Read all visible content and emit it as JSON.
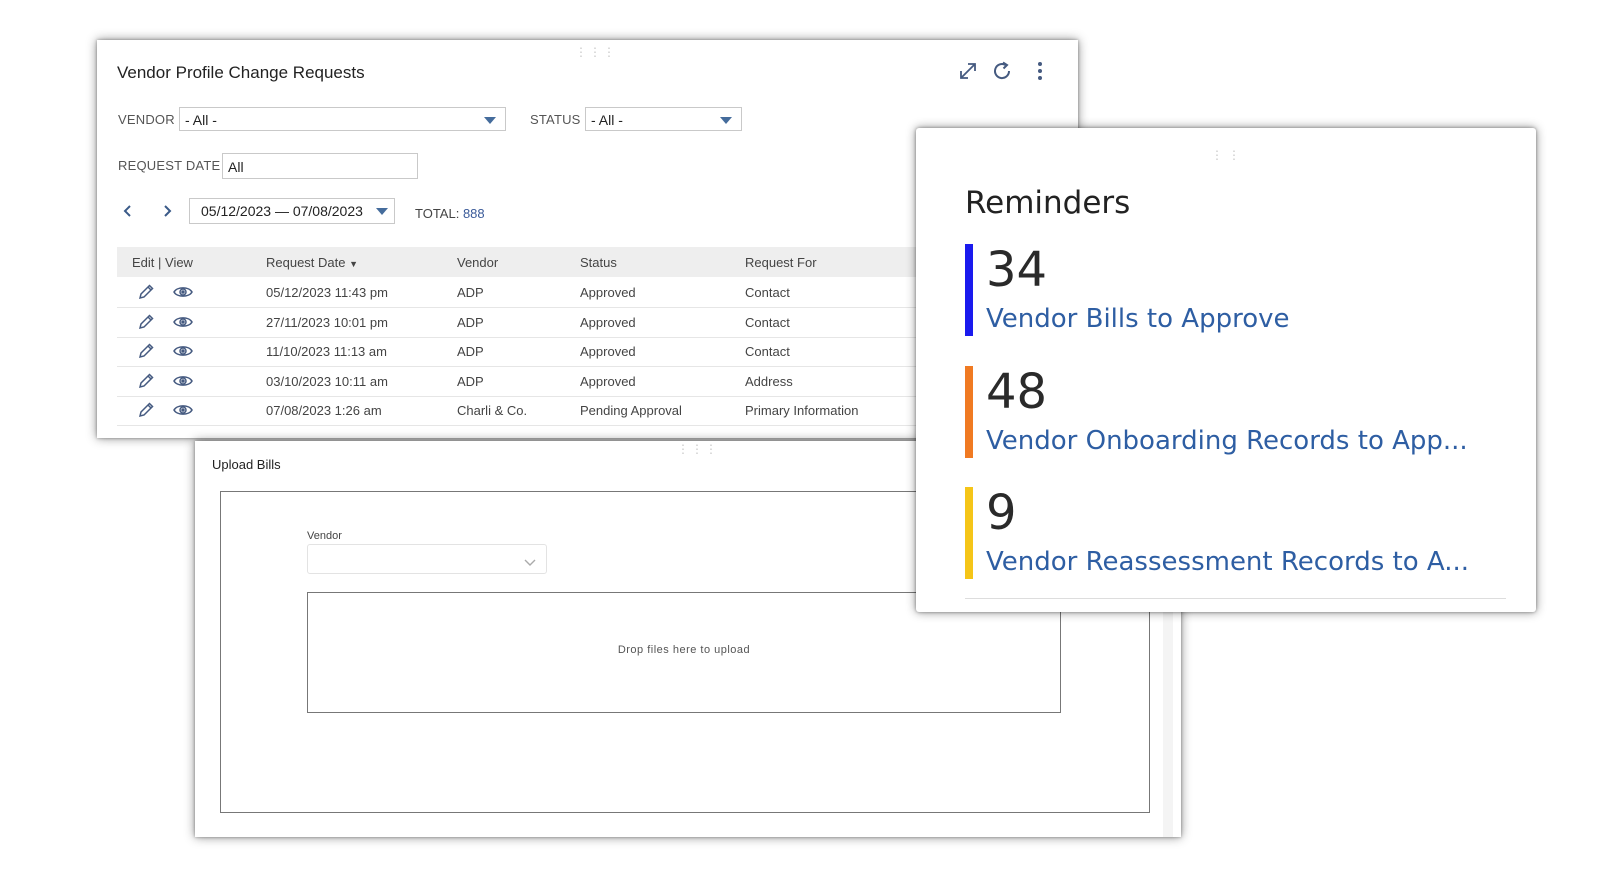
{
  "vendor_profile": {
    "title": "Vendor Profile Change Requests",
    "filters": {
      "vendor_label": "VENDOR",
      "vendor_value": "- All -",
      "status_label": "STATUS",
      "status_value": "- All -",
      "request_date_label": "REQUEST DATE",
      "request_date_value": "All"
    },
    "date_range": "05/12/2023 — 07/08/2023",
    "total_label": "TOTAL:",
    "total_value": "888",
    "columns": {
      "edit_view": "Edit | View",
      "request_date": "Request Date",
      "vendor": "Vendor",
      "status": "Status",
      "request_for": "Request For"
    },
    "rows": [
      {
        "date": "05/12/2023 11:43 pm",
        "vendor": "ADP",
        "status": "Approved",
        "request_for": "Contact"
      },
      {
        "date": "27/11/2023 10:01 pm",
        "vendor": "ADP",
        "status": "Approved",
        "request_for": "Contact"
      },
      {
        "date": "11/10/2023 11:13 am",
        "vendor": "ADP",
        "status": "Approved",
        "request_for": "Contact"
      },
      {
        "date": "03/10/2023 10:11 am",
        "vendor": "ADP",
        "status": "Approved",
        "request_for": "Address"
      },
      {
        "date": "07/08/2023 1:26 am",
        "vendor": "Charli & Co.",
        "status": "Pending Approval",
        "request_for": "Primary Information"
      }
    ],
    "icons": [
      "expand-icon",
      "refresh-icon",
      "more-vertical-icon",
      "chevron-left-icon",
      "chevron-right-icon",
      "pencil-icon",
      "eye-icon",
      "sort-desc-icon"
    ]
  },
  "upload_bills": {
    "title": "Upload Bills",
    "vendor_label": "Vendor",
    "vendor_value": "",
    "dropzone_text": "Drop files here to upload"
  },
  "reminders": {
    "title": "Reminders",
    "items": [
      {
        "count": "34",
        "label": "Vendor Bills to Approve",
        "color": "#1a1aee"
      },
      {
        "count": "48",
        "label": "Vendor Onboarding Records to App...",
        "color": "#f07a22"
      },
      {
        "count": "9",
        "label": "Vendor Reassessment Records to A...",
        "color": "#f5c518"
      }
    ]
  },
  "colors": {
    "link": "#2e5ea3",
    "accent": "#456c9c",
    "header_bg": "#eeeeee"
  }
}
